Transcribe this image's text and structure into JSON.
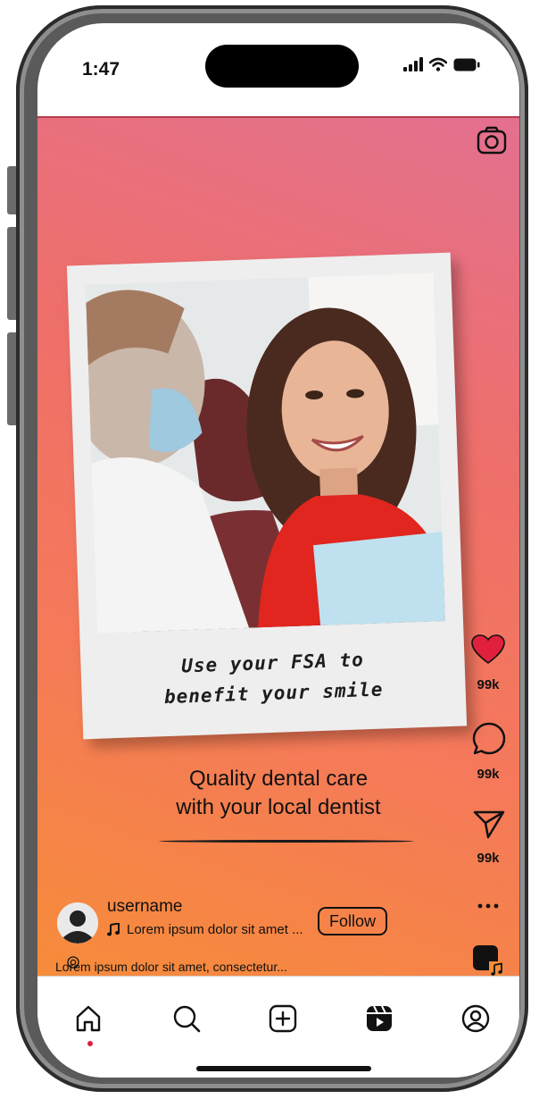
{
  "status_bar": {
    "time": "1:47"
  },
  "post": {
    "polaroid_caption_line1": "Use your FSA to",
    "polaroid_caption_line2": "benefit your smile",
    "headline_line1": "Quality dental care",
    "headline_line2": "with your local dentist",
    "photo_description_icon": "smiling-patient-with-dentist-photo"
  },
  "actions": {
    "likes": "99k",
    "comments": "99k",
    "shares": "99k",
    "more_icon": "more-icon"
  },
  "user": {
    "username": "username",
    "music": "Lorem ipsum dolor sit amet ...",
    "follow_label": "Follow",
    "caption": "Lorem ipsum dolor sit amet, consectetur..."
  },
  "nav": {
    "items": [
      "home-icon",
      "search-icon",
      "create-icon",
      "reels-icon",
      "profile-icon"
    ],
    "active": "home-icon"
  },
  "colors": {
    "gradient_top": "#e3708f",
    "gradient_bottom": "#f68c3a",
    "like": "#e0203d"
  }
}
